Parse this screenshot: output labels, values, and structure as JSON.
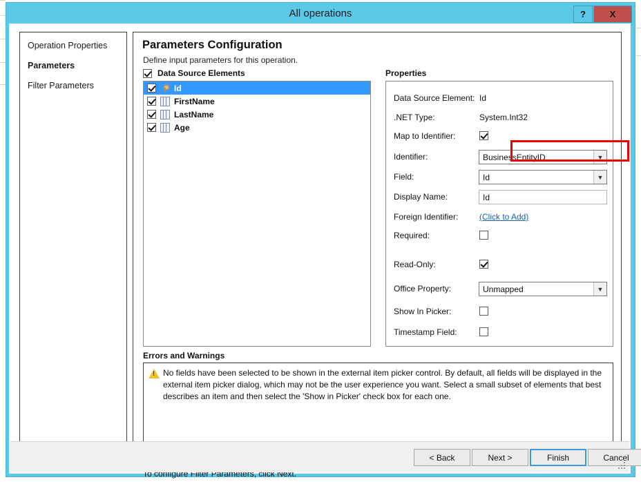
{
  "window": {
    "title": "All operations",
    "help_label": "?",
    "close_label": "X"
  },
  "nav": {
    "items": [
      {
        "label": "Operation Properties",
        "current": false
      },
      {
        "label": "Parameters",
        "current": true
      },
      {
        "label": "Filter Parameters",
        "current": false
      }
    ]
  },
  "page": {
    "title": "Parameters Configuration",
    "subtitle": "Define input parameters for this operation.",
    "hint": "To configure Filter Parameters, click Next."
  },
  "data_source_elements": {
    "caption": "Data Source Elements",
    "all_checked": true,
    "items": [
      {
        "label": "Id",
        "checked": true,
        "icon": "key-icon",
        "selected": true
      },
      {
        "label": "FirstName",
        "checked": true,
        "icon": "column-icon",
        "selected": false
      },
      {
        "label": "LastName",
        "checked": true,
        "icon": "column-icon",
        "selected": false
      },
      {
        "label": "Age",
        "checked": true,
        "icon": "column-icon",
        "selected": false
      }
    ]
  },
  "properties": {
    "caption": "Properties",
    "data_source_element": {
      "label": "Data Source Element:",
      "value": "Id"
    },
    "net_type": {
      "label": ".NET Type:",
      "value": "System.Int32"
    },
    "map_to_identifier": {
      "label": "Map to Identifier:",
      "checked": true
    },
    "identifier": {
      "label": "Identifier:",
      "value": "BusinessEntityID"
    },
    "field": {
      "label": "Field:",
      "value": "Id"
    },
    "display_name": {
      "label": "Display Name:",
      "value": "Id"
    },
    "foreign_identifier": {
      "label": "Foreign Identifier:",
      "value": "(Click to Add)"
    },
    "required": {
      "label": "Required:",
      "checked": false
    },
    "read_only": {
      "label": "Read-Only:",
      "checked": true
    },
    "office_property": {
      "label": "Office Property:",
      "value": "Unmapped"
    },
    "show_in_picker": {
      "label": "Show In Picker:",
      "checked": false
    },
    "timestamp_field": {
      "label": "Timestamp Field:",
      "checked": false
    }
  },
  "errors_and_warnings": {
    "caption": "Errors and Warnings",
    "message": "No fields have been selected to be shown in the external item picker control. By default, all fields will be displayed in the external item picker dialog, which may not be the user experience you want. Select a small subset of elements that best describes an item and then select the 'Show in Picker' check box for each one."
  },
  "footer": {
    "back": "< Back",
    "next": "Next >",
    "finish": "Finish",
    "cancel": "Cancel"
  },
  "colors": {
    "titlebar": "#5bc8e8",
    "close": "#c0504d",
    "selection": "#3399ff",
    "link": "#1562b0",
    "highlight": "#ee0000",
    "warning": "#f2c12e"
  },
  "icons": {
    "chevron_down": "⌄"
  }
}
